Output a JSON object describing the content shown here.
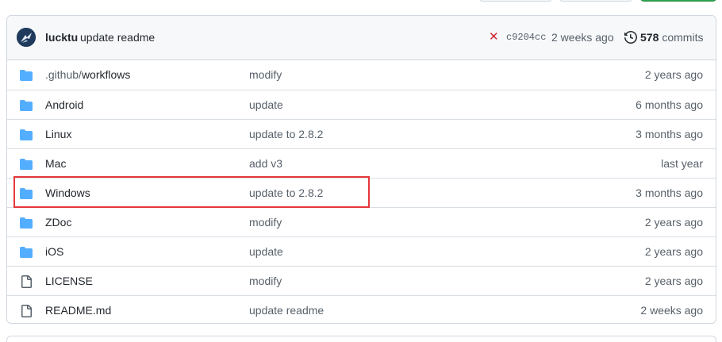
{
  "commit": {
    "author": "lucktu",
    "message": "update readme",
    "status": "✕",
    "sha": "c9204cc",
    "time": "2 weeks ago",
    "count": "578",
    "count_label": "commits"
  },
  "files": [
    {
      "name_prefix": ".github/",
      "name": "workflows",
      "type": "folder",
      "message": "modify",
      "age": "2 years ago"
    },
    {
      "name_prefix": "",
      "name": "Android",
      "type": "folder",
      "message": "update",
      "age": "6 months ago"
    },
    {
      "name_prefix": "",
      "name": "Linux",
      "type": "folder",
      "message": "update to 2.8.2",
      "age": "3 months ago"
    },
    {
      "name_prefix": "",
      "name": "Mac",
      "type": "folder",
      "message": "add v3",
      "age": "last year"
    },
    {
      "name_prefix": "",
      "name": "Windows",
      "type": "folder",
      "message": "update to 2.8.2",
      "age": "3 months ago"
    },
    {
      "name_prefix": "",
      "name": "ZDoc",
      "type": "folder",
      "message": "modify",
      "age": "2 years ago"
    },
    {
      "name_prefix": "",
      "name": "iOS",
      "type": "folder",
      "message": "update",
      "age": "2 years ago"
    },
    {
      "name_prefix": "",
      "name": "LICENSE",
      "type": "file",
      "message": "modify",
      "age": "2 years ago"
    },
    {
      "name_prefix": "",
      "name": "README.md",
      "type": "file",
      "message": "update readme",
      "age": "2 weeks ago"
    }
  ],
  "colors": {
    "folder": "#54aeff",
    "file": "#57606a",
    "highlight": "#e5383b",
    "status_fail": "#cf222e"
  }
}
